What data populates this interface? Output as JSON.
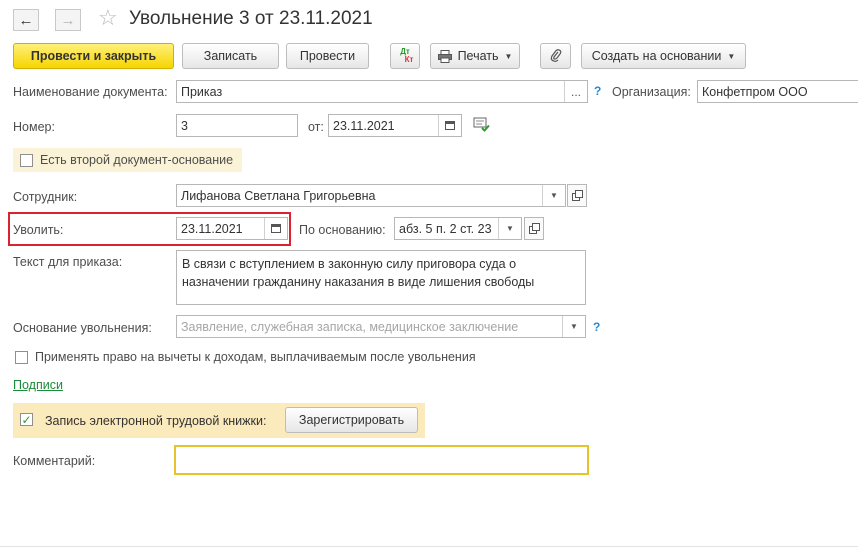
{
  "window": {
    "title": "Увольнение 3 от 23.11.2021"
  },
  "toolbar": {
    "post_and_close": "Провести и закрыть",
    "save": "Записать",
    "post": "Провести",
    "dtkt_top": "Дт",
    "dtkt_bottom": "Кт",
    "print": "Печать",
    "create_based_on": "Создать на основании"
  },
  "form": {
    "doc_name_label": "Наименование документа:",
    "doc_name_value": "Приказ",
    "org_label": "Организация:",
    "org_value": "Конфетпром ООО",
    "number_label": "Номер:",
    "number_value": "3",
    "date_label": "от:",
    "date_value": "23.11.2021",
    "second_doc_label": "Есть второй документ-основание",
    "employee_label": "Сотрудник:",
    "employee_value": "Лифанова Светлана Григорьевна",
    "dismiss_label": "Уволить:",
    "dismiss_value": "23.11.2021",
    "basis_label": "По основанию:",
    "basis_value": "абз. 5 п. 2 ст. 23",
    "order_text_label": "Текст для приказа:",
    "order_text_line1": "В связи с вступлением в законную силу приговора суда о",
    "order_text_line2": "назначении гражданину наказания в виде лишения свободы",
    "dismissal_reason_label": "Основание увольнения:",
    "dismissal_reason_placeholder": "Заявление, служебная записка, медицинское заключение",
    "deductions_label": "Применять право на вычеты к доходам, выплачиваемым после увольнения",
    "signatures_link": "Подписи",
    "etk_label": "Запись электронной трудовой книжки:",
    "register_button": "Зарегистрировать",
    "comment_label": "Комментарий:",
    "comment_value": "",
    "help_mark": "?"
  },
  "colors": {
    "primary_button": "#f6d500",
    "highlight_border": "#d9232e",
    "etk_background": "#fbeabb",
    "link": "#1a8c3a",
    "comment_border": "#e8c22a"
  }
}
